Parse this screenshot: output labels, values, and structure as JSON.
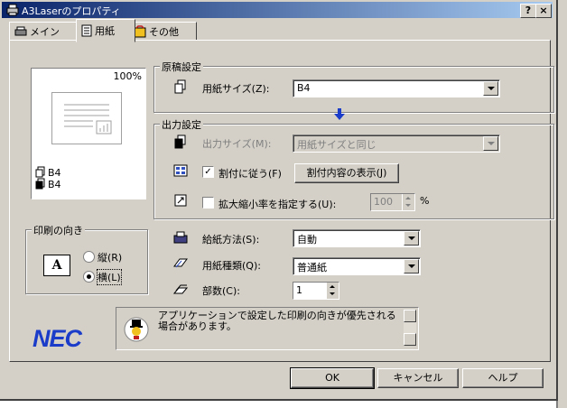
{
  "window": {
    "title": "A3Laserのプロパティ",
    "help_btn": "?",
    "close_btn": "×"
  },
  "tabs": [
    {
      "label": "メイン",
      "active": false
    },
    {
      "label": "用紙",
      "active": true
    },
    {
      "label": "その他",
      "active": false
    }
  ],
  "preview": {
    "zoom": "100%",
    "source_size": "B4",
    "output_size": "B4"
  },
  "original": {
    "group_label": "原稿設定",
    "paper_size_label": "用紙サイズ(Z):",
    "paper_size_value": "B4"
  },
  "output": {
    "group_label": "出力設定",
    "output_size_label": "出力サイズ(M):",
    "output_size_value": "用紙サイズと同じ",
    "fit_label": "割付に従う(F)",
    "fit_checked": true,
    "fit_button": "割付内容の表示(J)",
    "scale_label": "拡大縮小率を指定する(U):",
    "scale_checked": false,
    "scale_value": "100",
    "scale_unit": "%"
  },
  "orientation": {
    "group_label": "印刷の向き",
    "portrait": "縦(R)",
    "landscape": "横(L)",
    "selected": "landscape",
    "icon_letter": "A"
  },
  "feed": {
    "source_label": "給紙方法(S):",
    "source_value": "自動",
    "type_label": "用紙種類(Q):",
    "type_value": "普通紙",
    "copies_label": "部数(C):",
    "copies_value": "1"
  },
  "info": {
    "brand": "NEC",
    "message": "アプリケーションで設定した印刷の向きが優先される場合があります。"
  },
  "buttons": {
    "ok": "OK",
    "cancel": "キャンセル",
    "help": "ヘルプ"
  },
  "colors": {
    "accent_blue": "#1a3cc8",
    "face": "#d4d0c8"
  }
}
